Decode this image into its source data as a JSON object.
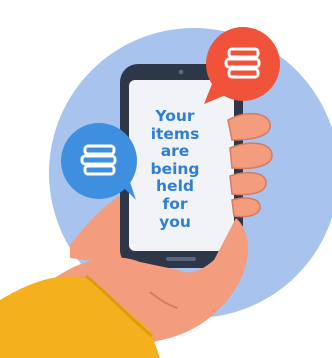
{
  "screen": {
    "message": "Your\nitems\nare\nbeing\nheld\nfor\nyou"
  },
  "icons": {
    "right_bubble": "books-icon",
    "left_bubble": "books-icon"
  },
  "colors": {
    "background_circle": "#a9c3ef",
    "phone_body": "#2d3748",
    "phone_screen": "#f1f3f6",
    "message_text": "#2f7fd3",
    "hand": "#f39c7e",
    "sleeve": "#f5b11d",
    "right_bubble": "#f0523a",
    "left_bubble": "#3f8fe0"
  }
}
